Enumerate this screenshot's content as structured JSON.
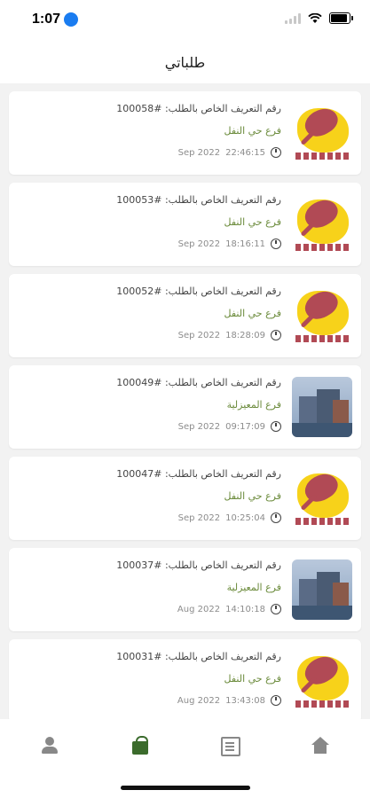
{
  "status": {
    "time": "1:07"
  },
  "header": {
    "title": "طلباتي"
  },
  "orders": [
    {
      "id_text": "رقم التعريف الخاص بالطلب: #100058",
      "branch": "فرع حي النفل",
      "date": "Sep 2022",
      "time": "22:46:15",
      "thumb": "logo"
    },
    {
      "id_text": "رقم التعريف الخاص بالطلب: #100053",
      "branch": "فرع حي النفل",
      "date": "Sep 2022",
      "time": "18:16:11",
      "thumb": "logo"
    },
    {
      "id_text": "رقم التعريف الخاص بالطلب: #100052",
      "branch": "فرع حي النفل",
      "date": "Sep 2022",
      "time": "18:28:09",
      "thumb": "logo"
    },
    {
      "id_text": "رقم التعريف الخاص بالطلب: #100049",
      "branch": "فرع المعيزلية",
      "date": "Sep 2022",
      "time": "09:17:09",
      "thumb": "photo"
    },
    {
      "id_text": "رقم التعريف الخاص بالطلب: #100047",
      "branch": "فرع حي النفل",
      "date": "Sep 2022",
      "time": "10:25:04",
      "thumb": "logo"
    },
    {
      "id_text": "رقم التعريف الخاص بالطلب: #100037",
      "branch": "فرع المعيزلية",
      "date": "Aug 2022",
      "time": "14:10:18",
      "thumb": "photo"
    },
    {
      "id_text": "رقم التعريف الخاص بالطلب: #100031",
      "branch": "فرع حي النفل",
      "date": "Aug 2022",
      "time": "13:43:08",
      "thumb": "logo"
    }
  ],
  "tabs": [
    {
      "name": "profile",
      "icon": "user-icon"
    },
    {
      "name": "orders",
      "icon": "bag-icon",
      "active": true
    },
    {
      "name": "menu",
      "icon": "menu-icon"
    },
    {
      "name": "home",
      "icon": "home-icon"
    }
  ],
  "colors": {
    "accent": "#3b6b2c",
    "branch": "#6a8a3a",
    "logo_yellow": "#f7d21a",
    "logo_red": "#b14a55"
  }
}
